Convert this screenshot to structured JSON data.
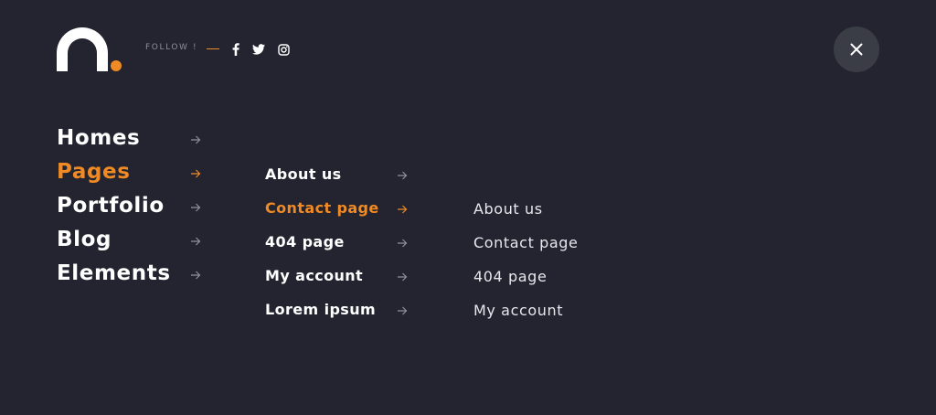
{
  "header": {
    "follow_label": "FOLLOW !",
    "social": [
      {
        "icon": "facebook-icon"
      },
      {
        "icon": "twitter-icon"
      },
      {
        "icon": "instagram-icon"
      }
    ],
    "close_icon": "close-icon"
  },
  "colors": {
    "background": "#23242f",
    "accent": "#f08a24",
    "text": "#ffffff",
    "muted": "#8e909a",
    "close_bg": "#3a3c46"
  },
  "menu": {
    "level1": [
      {
        "label": "Homes",
        "active": false
      },
      {
        "label": "Pages",
        "active": true
      },
      {
        "label": "Portfolio",
        "active": false
      },
      {
        "label": "Blog",
        "active": false
      },
      {
        "label": "Elements",
        "active": false
      }
    ],
    "level2": [
      {
        "label": "About us",
        "active": false
      },
      {
        "label": "Contact page",
        "active": true
      },
      {
        "label": "404 page",
        "active": false
      },
      {
        "label": "My account",
        "active": false
      },
      {
        "label": "Lorem ipsum",
        "active": false
      }
    ],
    "level3": [
      {
        "label": "About us"
      },
      {
        "label": "Contact page"
      },
      {
        "label": "404 page"
      },
      {
        "label": "My account"
      }
    ]
  }
}
